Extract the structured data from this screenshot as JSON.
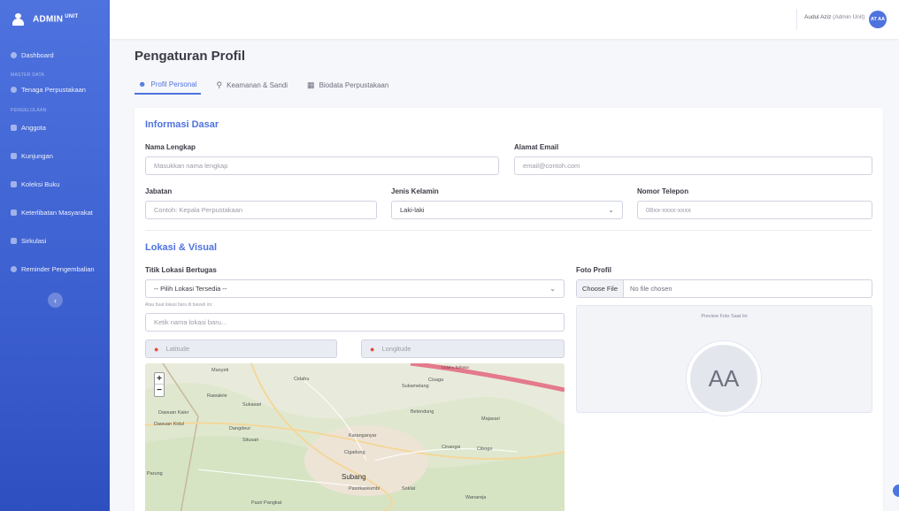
{
  "sidebar": {
    "brand": "ADMIN",
    "brand_sup": "UNIT",
    "items": [
      {
        "label": "Dashboard"
      },
      {
        "label": "Tenaga Perpustakaan"
      },
      {
        "label": "Anggota"
      },
      {
        "label": "Kunjungan"
      },
      {
        "label": "Koleksi Buku"
      },
      {
        "label": "Keterlibatan Masyarakat"
      },
      {
        "label": "Sirkulasi"
      },
      {
        "label": "Reminder Pengembalian"
      }
    ],
    "section_master": "MASTER DATA",
    "section_pengelolaan": "PENGELOLAAN",
    "toggle_icon": "chevron-left-icon"
  },
  "topbar": {
    "user_name": "Audul Aziz",
    "user_role": "(Admin Unit)",
    "avatar_initials": "AT AA"
  },
  "page": {
    "title": "Pengaturan Profil",
    "tabs": [
      {
        "label": "Profil Personal",
        "icon": "user-icon",
        "active": true
      },
      {
        "label": "Keamanan & Sandi",
        "icon": "key-icon",
        "active": false
      },
      {
        "label": "Biodata Perpustakaan",
        "icon": "building-icon",
        "active": false
      }
    ]
  },
  "form": {
    "basic_title": "Informasi Dasar",
    "nama": {
      "label": "Nama Lengkap",
      "placeholder": "Masukkan nama lengkap"
    },
    "email": {
      "label": "Alamat Email",
      "placeholder": "email@contoh.com"
    },
    "jabatan": {
      "label": "Jabatan",
      "placeholder": "Contoh: Kepala Perpustakaan"
    },
    "gender": {
      "label": "Jenis Kelamin",
      "value": "Laki-laki"
    },
    "phone": {
      "label": "Nomor Telepon",
      "placeholder": "08xx-xxxx-xxxx"
    },
    "location_title": "Lokasi & Visual",
    "titik": {
      "label": "Titik Lokasi Bertugas",
      "value": "-- Pilih Lokasi Tersedia --",
      "hint": "Atau buat lokasi baru di bawah ini:",
      "new_placeholder": "Ketik nama lokasi baru..."
    },
    "latitude": {
      "placeholder": "Latitude"
    },
    "longitude": {
      "placeholder": "Longitude"
    },
    "foto": {
      "label": "Foto Profil",
      "button": "Choose File",
      "status": "No file chosen",
      "preview_label": "Preview Foto Saat Ini",
      "avatar": "AA"
    }
  },
  "map": {
    "zoom_in": "+",
    "zoom_out": "−",
    "places": [
      "Manyeti",
      "Cidahu",
      "Rawalele",
      "Sukamelang",
      "Cisaga",
      "Sukasari",
      "Dawuan Kaler",
      "Dawuan Kidul",
      "Dangdeur",
      "Belendung",
      "Majasari",
      "Situsari",
      "Karanganyar",
      "Cigadung",
      "Cinangsi",
      "Cibogo",
      "Subang",
      "Pasirkareumbi",
      "Soklat",
      "Wanareja",
      "Pasir Pangkat",
      "Parung",
      "Cidahu Bahasa"
    ]
  }
}
